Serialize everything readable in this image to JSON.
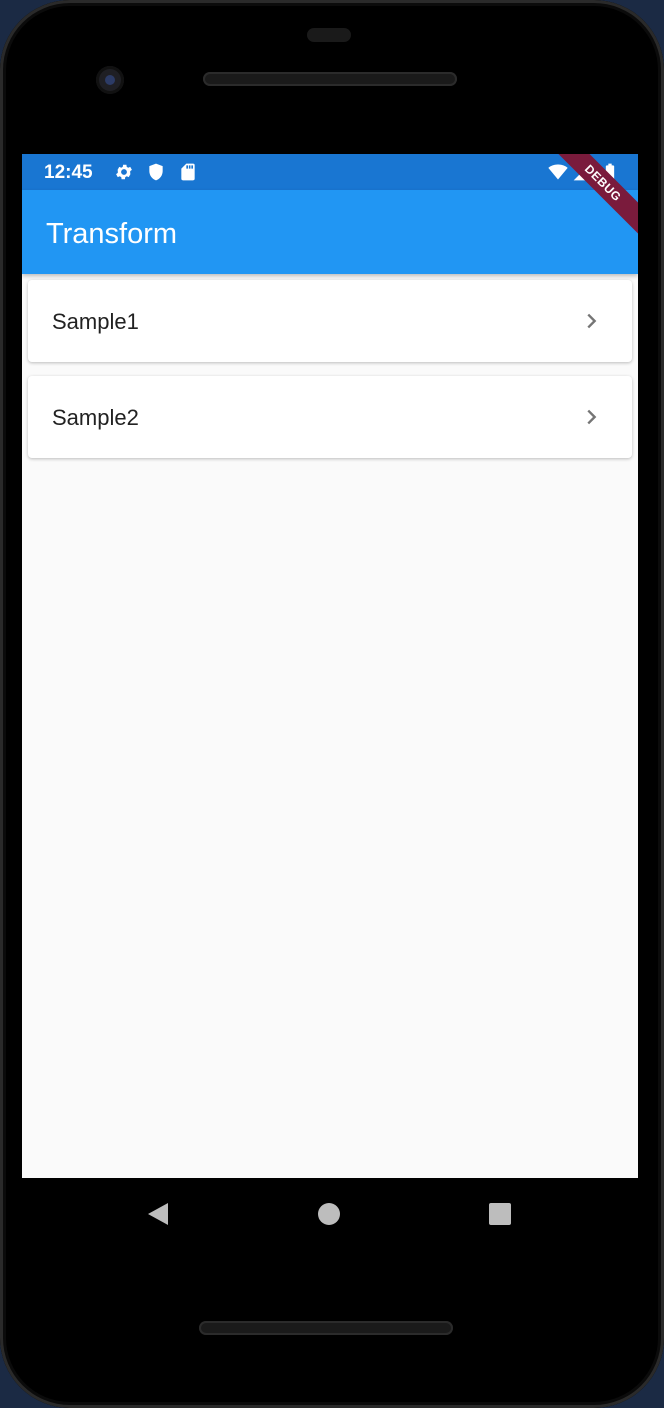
{
  "status_bar": {
    "time": "12:45",
    "left_icons": [
      "gear-icon",
      "shield-icon",
      "sd-card-icon"
    ],
    "right_icons": [
      "wifi-icon",
      "signal-icon",
      "battery-icon"
    ]
  },
  "debug_banner": "DEBUG",
  "app_bar": {
    "title": "Transform",
    "color": "#2196f3"
  },
  "list": {
    "items": [
      {
        "label": "Sample1",
        "icon": "chevron-right-icon"
      },
      {
        "label": "Sample2",
        "icon": "chevron-right-icon"
      }
    ]
  },
  "nav_bar": {
    "buttons": [
      "back-icon",
      "home-icon",
      "recents-icon"
    ]
  },
  "colors": {
    "status_bar": "#1976d2",
    "app_bar": "#2196f3",
    "background": "#fafafa",
    "debug": "#7a1b3c"
  }
}
